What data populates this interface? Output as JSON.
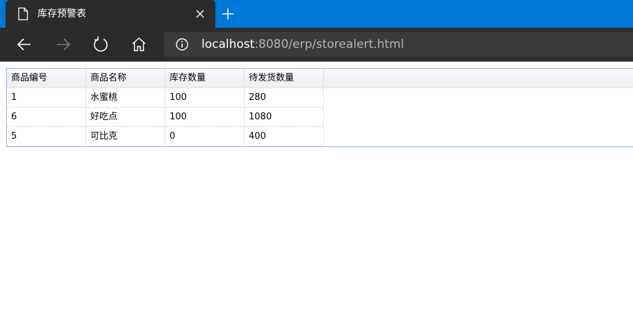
{
  "browser": {
    "tab_title": "库存预警表",
    "url_host": "localhost",
    "url_rest": ":8080/erp/storealert.html",
    "accent_color": "#0078d7",
    "icons": [
      "document-icon",
      "close-icon",
      "new-tab-icon",
      "back-icon",
      "forward-icon",
      "refresh-icon",
      "home-icon",
      "info-icon"
    ]
  },
  "grid": {
    "headers": [
      "商品编号",
      "商品名称",
      "库存数量",
      "待发货数量"
    ],
    "rows": [
      [
        "1",
        "水蜜桃",
        "100",
        "280"
      ],
      [
        "6",
        "好吃点",
        "100",
        "1080"
      ],
      [
        "5",
        "可比克",
        "0",
        "400"
      ]
    ]
  }
}
